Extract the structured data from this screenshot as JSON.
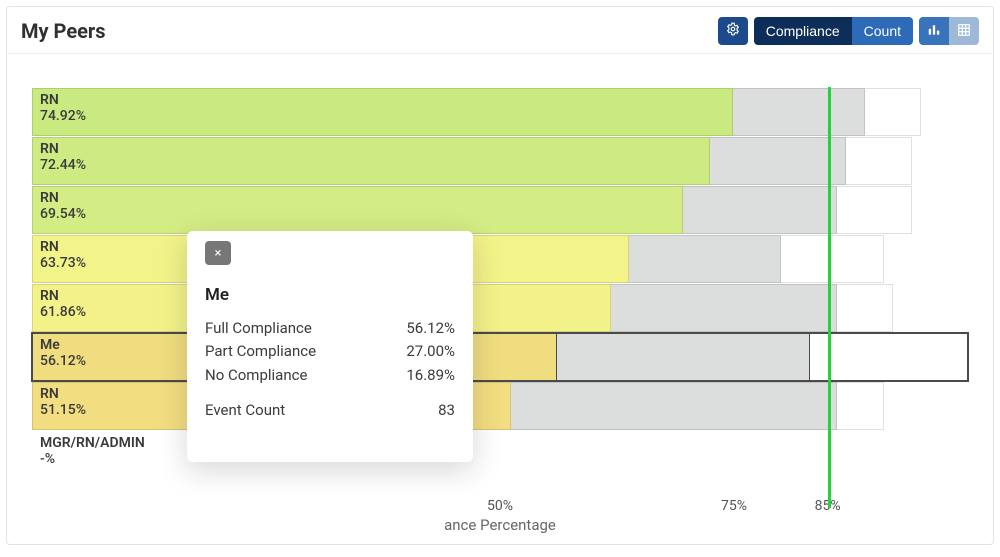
{
  "header": {
    "title": "My Peers",
    "toggle1": {
      "option_a": "Compliance",
      "option_b": "Count",
      "active": "a"
    },
    "icon_settings": "settings",
    "icon_chart": "bar-chart",
    "icon_table": "table"
  },
  "chart_data": {
    "type": "bar",
    "orientation": "horizontal",
    "xlabel": "Compliance Percentage",
    "xlabel_visible_fragment": "ance Percentage",
    "xlim": [
      0,
      100
    ],
    "ticks": [
      50,
      75,
      85
    ],
    "tick_labels": [
      "50%",
      "75%",
      "85%"
    ],
    "goal_line": 85,
    "series_meaning": [
      "full_compliance_pct",
      "part_plus_full_pct",
      "total_events_pct"
    ],
    "rows": [
      {
        "label": "RN",
        "full": 74.92,
        "part_end": 89,
        "total_end": 95,
        "color": "#c9ea80"
      },
      {
        "label": "RN",
        "full": 72.44,
        "part_end": 87,
        "total_end": 94,
        "color": "#cdeb82"
      },
      {
        "label": "RN",
        "full": 69.54,
        "part_end": 86,
        "total_end": 94,
        "color": "#d4ec84"
      },
      {
        "label": "RN",
        "full": 63.73,
        "part_end": 80,
        "total_end": 91,
        "color": "#f2f389"
      },
      {
        "label": "RN",
        "full": 61.86,
        "part_end": 86,
        "total_end": 92,
        "color": "#f3f289"
      },
      {
        "label": "Me",
        "full": 56.12,
        "part_end": 83.12,
        "total_end": 100,
        "color": "#f0dd7f",
        "me": true
      },
      {
        "label": "RN",
        "full": 51.15,
        "part_end": 86,
        "total_end": 91,
        "color": "#f2de80"
      },
      {
        "label": "MGR/RN/ADMIN",
        "full": null,
        "part_end": null,
        "total_end": null,
        "color": "#ffffff",
        "display": "-%"
      }
    ]
  },
  "tooltip": {
    "title": "Me",
    "close": "×",
    "rows": [
      {
        "label": "Full Compliance",
        "value": "56.12%"
      },
      {
        "label": "Part Compliance",
        "value": "27.00%"
      },
      {
        "label": "No Compliance",
        "value": "16.89%"
      }
    ],
    "event_count_label": "Event Count",
    "event_count_value": "83"
  }
}
